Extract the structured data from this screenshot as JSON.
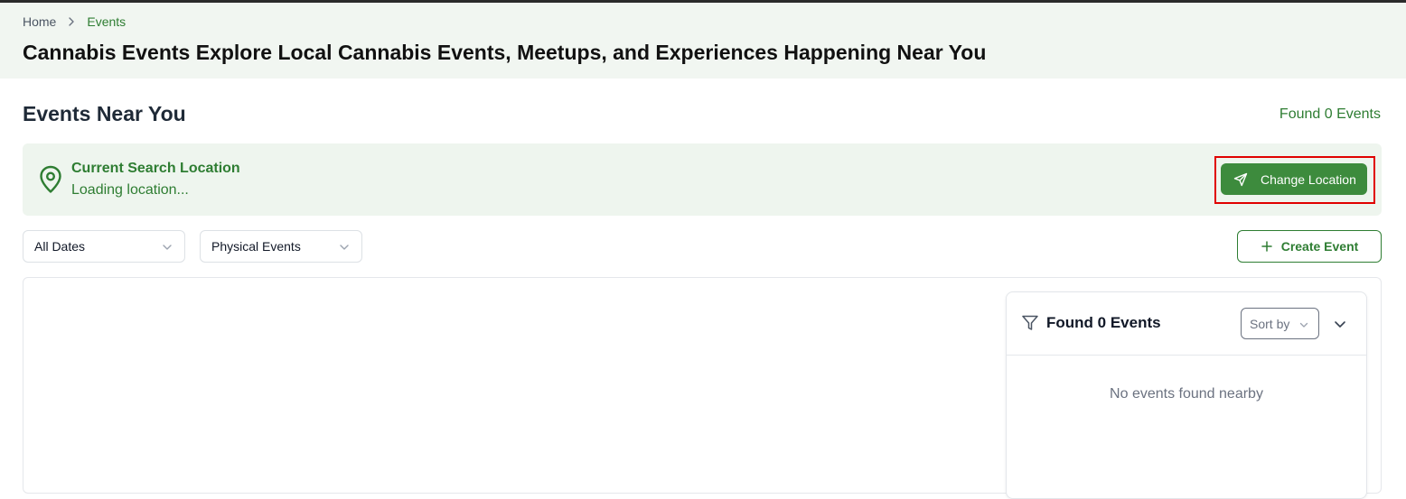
{
  "breadcrumb": {
    "home": "Home",
    "current": "Events"
  },
  "header": {
    "title_bold": "Cannabis Events",
    "title_rest": "Explore Local Cannabis Events, Meetups, and Experiences Happening Near You"
  },
  "section": {
    "title": "Events Near You",
    "found_count_text": "Found 0 Events"
  },
  "location": {
    "title": "Current Search Location",
    "status": "Loading location...",
    "change_button": "Change Location"
  },
  "filters": {
    "date_select": "All Dates",
    "type_select": "Physical Events",
    "create_button": "Create Event"
  },
  "results": {
    "title": "Found 0 Events",
    "sort_placeholder": "Sort by",
    "empty_message": "No events found nearby"
  },
  "icons": {
    "breadcrumb_separator": "chevron-right-icon",
    "location": "map-pin-icon",
    "change_location": "send-icon",
    "select_chevron": "chevron-down-icon",
    "create": "plus-icon",
    "filter": "filter-icon",
    "collapse": "chevron-down-icon"
  },
  "colors": {
    "brand_green": "#2e7d32",
    "button_green": "#3d8b3d",
    "header_bg": "#f1f6f1",
    "location_bg": "#eef5ee",
    "highlight_red": "#e00000"
  }
}
